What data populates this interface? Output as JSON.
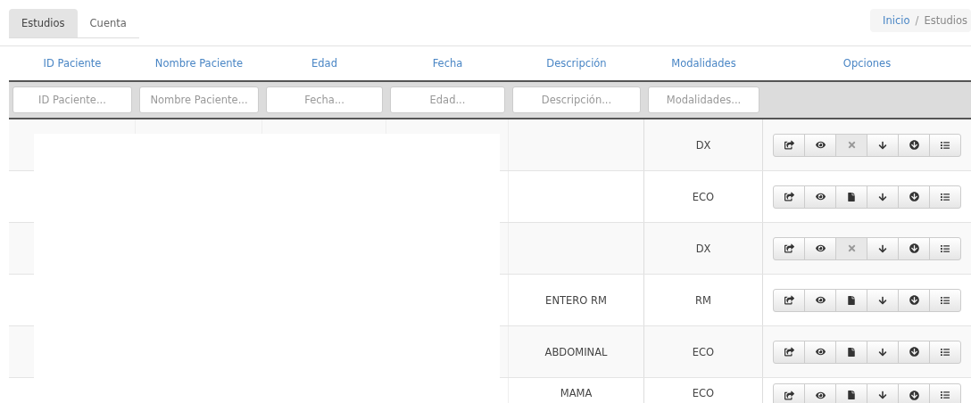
{
  "tabs": [
    {
      "label": "Estudios",
      "selected": true
    },
    {
      "label": "Cuenta",
      "selected": false
    }
  ],
  "breadcrumb": {
    "link": "Inicio",
    "separator": "/",
    "current": "Estudios"
  },
  "table": {
    "columns": [
      "ID Paciente",
      "Nombre Paciente",
      "Edad",
      "Fecha",
      "Descripción",
      "Modalidades",
      "Opciones"
    ],
    "filters": [
      {
        "placeholder": "ID Paciente..."
      },
      {
        "placeholder": "Nombre Paciente..."
      },
      {
        "placeholder": "Fecha..."
      },
      {
        "placeholder": "Edad..."
      },
      {
        "placeholder": "Descripción..."
      },
      {
        "placeholder": "Modalidades..."
      }
    ],
    "rows": [
      {
        "description": "",
        "modality": "DX",
        "report": false
      },
      {
        "description": "",
        "modality": "ECO",
        "report": true
      },
      {
        "description": "",
        "modality": "DX",
        "report": false
      },
      {
        "description": "ENTERO RM",
        "modality": "RM",
        "report": true
      },
      {
        "description": "ABDOMINAL",
        "modality": "ECO",
        "report": true
      },
      {
        "description": "MAMA",
        "modality": "ECO",
        "report": true
      }
    ]
  }
}
